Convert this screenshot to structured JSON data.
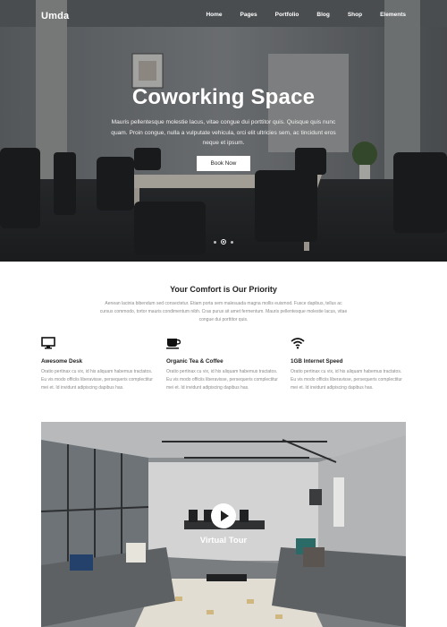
{
  "header": {
    "logo": "Umda",
    "nav": [
      "Home",
      "Pages",
      "Portfolio",
      "Blog",
      "Shop",
      "Elements"
    ]
  },
  "hero": {
    "title": "Coworking Space",
    "subtitle": "Mauris pellentesque molestie lacus, vitae congue dui porttitor quis. Quisque quis nunc quam. Proin congue, nulla a vulputate vehicula, orci elit ultricies sem, ac tincidunt eros neque et ipsum.",
    "button": "Book Now",
    "slides": 3,
    "active_slide": 2
  },
  "priority": {
    "title": "Your Comfort is Our Priority",
    "intro": "Aenean lacinia bibendum sed consectetur. Etiam porta sem malesuada magna mollis euismod. Fusce dapibus, tellus ac cursus commodo, tortor mauris condimentum nibh. Cras purus sit amet fermentum. Mauris pellentesque molestie lacus, vitae congue dui porttitor quis.",
    "features": [
      {
        "icon": "monitor-icon",
        "title": "Awesome Desk",
        "text": "Oratio pertinax cu vix, id his aliquam habemus tractatos. Eu vis modo officiis liberavisse, persequeris complectitur mei et. Id invidunt adipiscing dapibus has."
      },
      {
        "icon": "coffee-cup-icon",
        "title": "Organic Tea & Coffee",
        "text": "Oratio pertinax cu vix, id his aliquam habemus tractatos. Eu vis modo officiis liberavisse, persequeris complectitur mei et. Id invidunt adipiscing dapibus has."
      },
      {
        "icon": "wifi-icon",
        "title": "1GB Internet Speed",
        "text": "Oratio pertinax cu vix, id his aliquam habemus tractatos. Eu vis modo officiis liberavisse, persequeris complectitur mei et. Id invidunt adipiscing dapibus has."
      }
    ]
  },
  "video": {
    "title": "Virtual Tour"
  }
}
